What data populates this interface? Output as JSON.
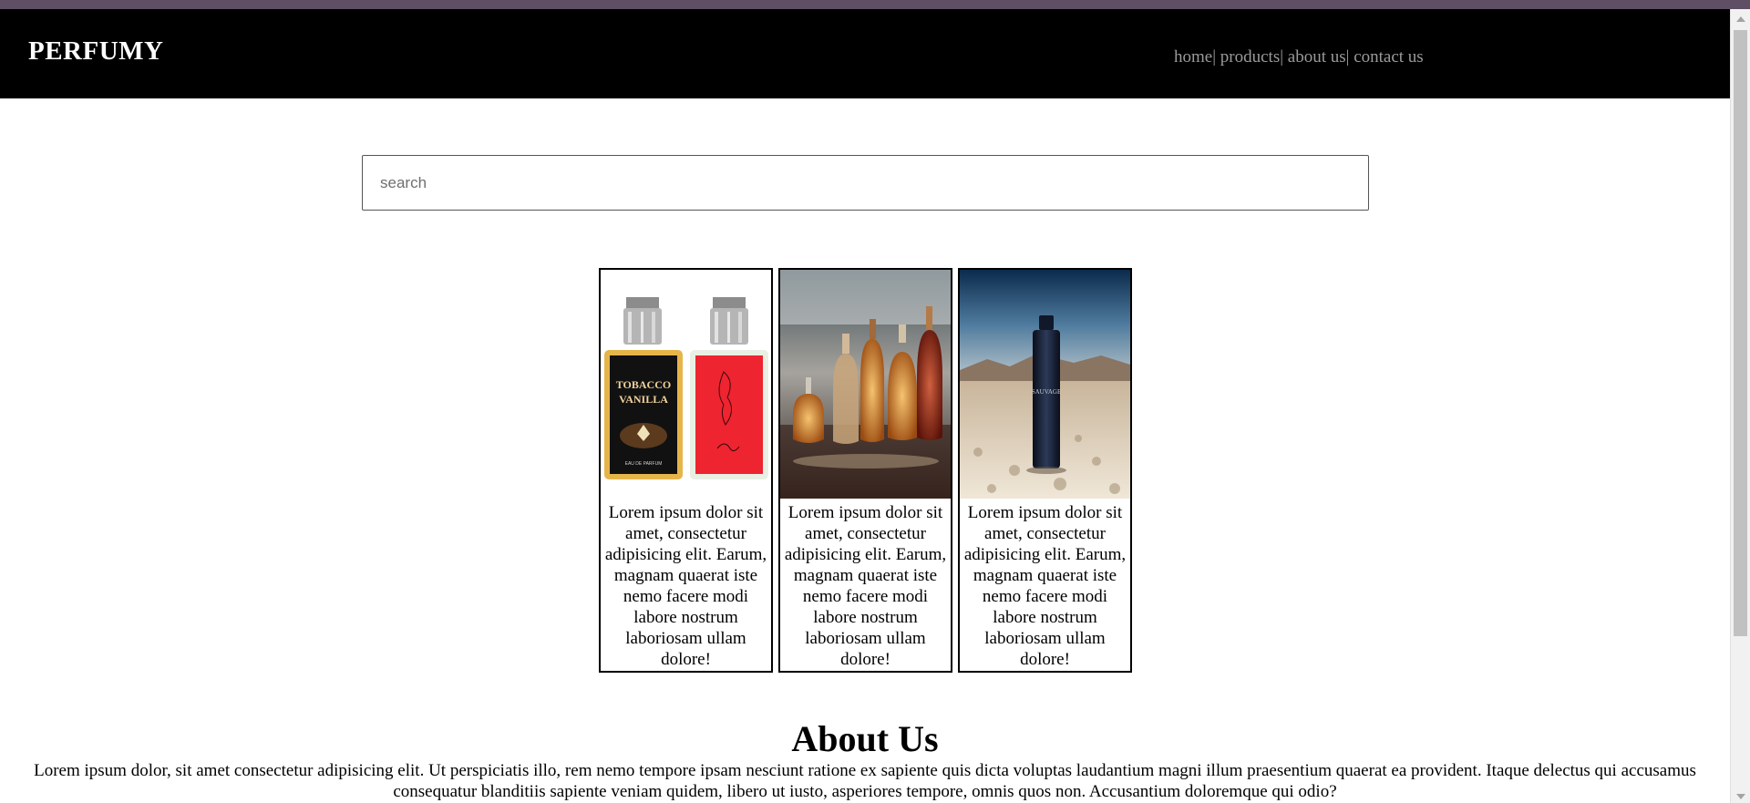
{
  "header": {
    "brand": "PERFUMY",
    "nav": {
      "home": "home",
      "products": "products",
      "about": "about us",
      "contact": "contact us",
      "separator": "|"
    }
  },
  "search": {
    "placeholder": "search",
    "value": ""
  },
  "products": [
    {
      "image_icon": "perfume-pair-image",
      "bottle_left_text_1": "TOBACCO",
      "bottle_left_text_2": "VANILLA",
      "bottle_left_text_3": "EAU DE PARFUM",
      "caption": "Lorem ipsum dolor sit amet, consectetur adipisicing elit. Earum, magnam quaerat iste nemo facere modi labore nostrum laboriosam ullam dolore!"
    },
    {
      "image_icon": "perfume-collection-image",
      "caption": "Lorem ipsum dolor sit amet, consectetur adipisicing elit. Earum, magnam quaerat iste nemo facere modi labore nostrum laboriosam ullam dolore!"
    },
    {
      "image_icon": "perfume-desert-image",
      "bottle_text": "SAUVAGE",
      "caption": "Lorem ipsum dolor sit amet, consectetur adipisicing elit. Earum, magnam quaerat iste nemo facere modi labore nostrum laboriosam ullam dolore!"
    }
  ],
  "about": {
    "title": "About Us",
    "body": "Lorem ipsum dolor, sit amet consectetur adipisicing elit. Ut perspiciatis illo, rem nemo tempore ipsam nesciunt ratione ex sapiente quis dicta voluptas laudantium magni illum praesentium quaerat ea provident. Itaque delectus qui accusamus consequatur blanditiis sapiente veniam quidem, libero ut iusto, asperiores tempore, omnis quos non. Accusantium doloremque qui odio?"
  },
  "colors": {
    "navbar": "#000000",
    "top_strip": "#5e4f64",
    "nav_link": "#9a9a9a",
    "brand": "#ffffff"
  }
}
